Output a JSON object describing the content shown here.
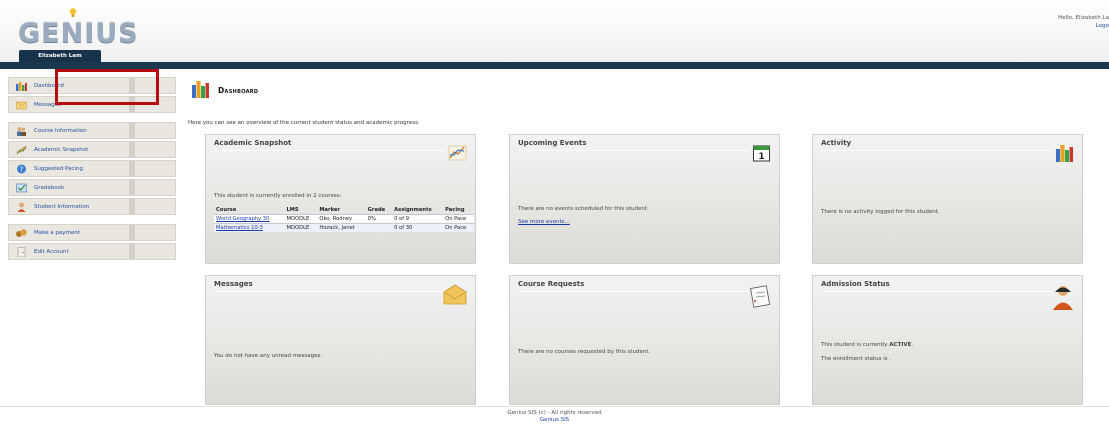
{
  "header": {
    "logo_text": "GENIUS",
    "user_tab": "Elizabeth Lam",
    "greeting": "Hello, Elizabeth La",
    "logout": "Logo"
  },
  "sidebar": {
    "items": [
      {
        "label": "Dashboard",
        "icon": "chart-books-icon"
      },
      {
        "label": "Messages",
        "icon": "envelope-icon"
      },
      {
        "label": "Course Information",
        "icon": "people-icon"
      },
      {
        "label": "Academic Snapshot",
        "icon": "graph-icon"
      },
      {
        "label": "Suggested Pacing",
        "icon": "help-icon"
      },
      {
        "label": "Gradebook",
        "icon": "checkbook-icon"
      },
      {
        "label": "Student Information",
        "icon": "student-icon"
      },
      {
        "label": "Make a payment",
        "icon": "money-icon"
      },
      {
        "label": "Edit Account",
        "icon": "door-icon"
      }
    ]
  },
  "main": {
    "title": "Dashboard",
    "intro": "Here you can see an overview of the current student status and academic progress."
  },
  "panels": {
    "academic": {
      "title": "Academic Snapshot",
      "enrolled": "This student is currently enrolled in 2 courses:",
      "columns": [
        "Course",
        "LMS",
        "Marker",
        "Grade",
        "Assignments",
        "Pacing"
      ],
      "rows": [
        [
          "World Geography 30",
          "MOODLE",
          "Oko, Rodney",
          "0%",
          "0 of 9",
          "On Pace"
        ],
        [
          "Mathematics 10-3",
          "MOODLE",
          "Hozack, Janet",
          "",
          "0 of 30",
          "On Pace"
        ]
      ]
    },
    "events": {
      "title": "Upcoming Events",
      "message": "There are no events scheduled for this student.",
      "link": "See more events...",
      "calendar_day": "1"
    },
    "activity": {
      "title": "Activity",
      "message": "There is no activity logged for this student."
    },
    "messages": {
      "title": "Messages",
      "message": "You do not have any unread messages."
    },
    "requests": {
      "title": "Course Requests",
      "message": "There are no courses requested by this student."
    },
    "admission": {
      "title": "Admission Status",
      "status_prefix": "This student is currently ",
      "status": "ACTIVE",
      "status_suffix": ".",
      "enrollment": "The enrollment status is ."
    }
  },
  "footer": {
    "copyright": "Genius SIS (c) - All rights reserved",
    "link": "Genius SIS"
  },
  "colors": {
    "nav_bar": "#1c3750",
    "link": "#1a3fa8",
    "highlight": "#b30d12",
    "sidebar_bg": "#e9e7e0"
  }
}
